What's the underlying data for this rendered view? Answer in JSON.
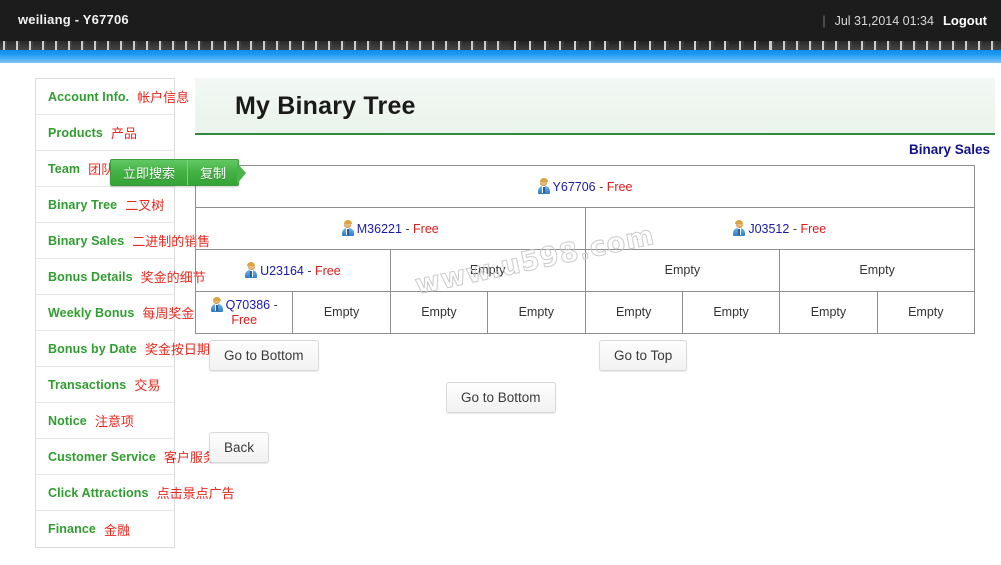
{
  "topbar": {
    "user": "weiliang - Y67706",
    "separator": "|",
    "datetime": "Jul 31,2014 01:34",
    "logout": "Logout"
  },
  "translate_popup": {
    "search_label": "立即搜索",
    "copy_label": "复制"
  },
  "sidebar": {
    "items": [
      {
        "en": "Account Info.",
        "zh": "帐户信息"
      },
      {
        "en": "Products",
        "zh": "产品"
      },
      {
        "en": "Team",
        "zh": "团队"
      },
      {
        "en": "Binary Tree",
        "zh": "二叉树"
      },
      {
        "en": "Binary Sales",
        "zh": "二进制的销售"
      },
      {
        "en": "Bonus Details",
        "zh": "奖金的细节"
      },
      {
        "en": "Weekly Bonus",
        "zh": "每周奖金"
      },
      {
        "en": "Bonus by Date",
        "zh": "奖金按日期"
      },
      {
        "en": "Transactions",
        "zh": "交易"
      },
      {
        "en": "Notice",
        "zh": "注意项"
      },
      {
        "en": "Customer Service",
        "zh": "客户服务"
      },
      {
        "en": "Click Attractions",
        "zh": "点击景点广告"
      },
      {
        "en": "Finance",
        "zh": "金融"
      }
    ]
  },
  "main": {
    "title": "My Binary Tree",
    "binary_sales_link": "Binary Sales",
    "watermark": "www.u598.com",
    "status_free": "Free",
    "empty_label": "Empty",
    "separator": " - ",
    "tree_rows": [
      {
        "colspan": 8,
        "cells": [
          {
            "type": "node",
            "id": "Y67706",
            "status": "Free"
          }
        ]
      },
      {
        "colspan": 4,
        "cells": [
          {
            "type": "node",
            "id": "M36221",
            "status": "Free"
          },
          {
            "type": "node",
            "id": "J03512",
            "status": "Free"
          }
        ]
      },
      {
        "colspan": 2,
        "cells": [
          {
            "type": "node",
            "id": "U23164",
            "status": "Free"
          },
          {
            "type": "empty",
            "label": "Empty"
          },
          {
            "type": "empty",
            "label": "Empty"
          },
          {
            "type": "empty",
            "label": "Empty"
          }
        ]
      },
      {
        "colspan": 1,
        "cells": [
          {
            "type": "node",
            "id": "Q70386",
            "status": "Free"
          },
          {
            "type": "empty",
            "label": "Empty"
          },
          {
            "type": "empty",
            "label": "Empty"
          },
          {
            "type": "empty",
            "label": "Empty"
          },
          {
            "type": "empty",
            "label": "Empty"
          },
          {
            "type": "empty",
            "label": "Empty"
          },
          {
            "type": "empty",
            "label": "Empty"
          },
          {
            "type": "empty",
            "label": "Empty"
          }
        ]
      }
    ],
    "buttons": {
      "go_to_bottom_left": "Go to Bottom",
      "go_to_top": "Go to Top",
      "go_to_bottom_mid": "Go to Bottom",
      "back": "Back"
    }
  },
  "colors": {
    "sidebar_en": "#2f9e2f",
    "sidebar_zh": "#e8281e",
    "node_id": "#1a1aa8",
    "status_free": "#e01b1b",
    "link": "#11118f",
    "topbar_bg": "#1c1c1c",
    "accent_green": "#2f8a3c"
  }
}
